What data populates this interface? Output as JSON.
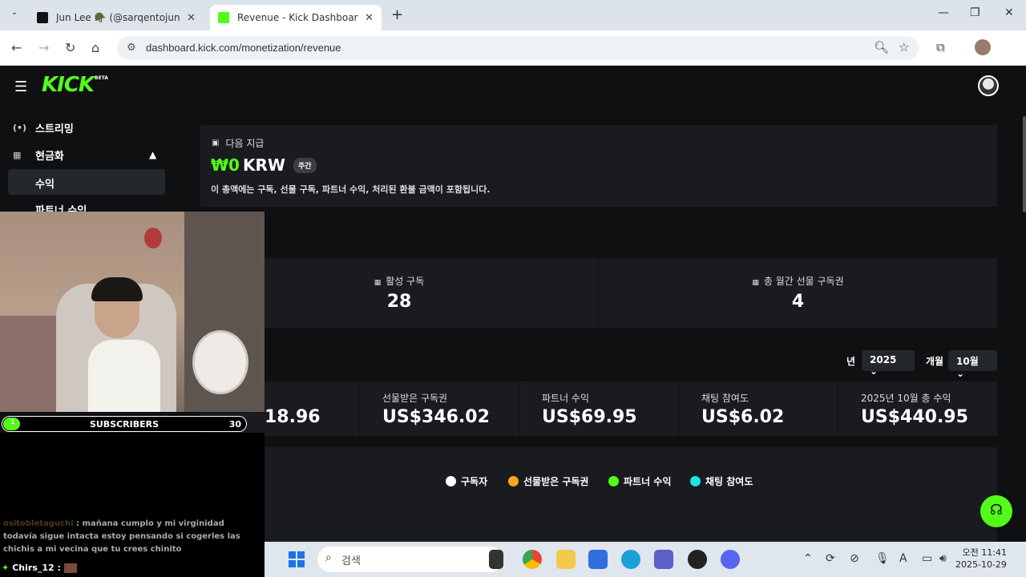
{
  "browser": {
    "tabs": [
      {
        "title": "Jun Lee 🪖 (@sarqentojunior_",
        "active": false
      },
      {
        "title": "Revenue - Kick Dashboard",
        "active": true
      }
    ],
    "url": "dashboard.kick.com/monetization/revenue",
    "icons": [
      "back-icon",
      "forward-icon",
      "reload-icon",
      "home-icon",
      "zoom-icon",
      "star-icon",
      "extensions-icon",
      "more-icon"
    ]
  },
  "header": {
    "logo": "KICK",
    "beta": "BETA"
  },
  "sidebar": {
    "items": [
      {
        "label": "스트리밍",
        "icon": "broadcast-icon"
      },
      {
        "label": "현금화",
        "icon": "chart-icon"
      }
    ],
    "sub_items": [
      {
        "label": "수익",
        "active": true
      },
      {
        "label": "파트너 수익",
        "active": false
      }
    ]
  },
  "payout": {
    "label": "다음 지급",
    "amount_symbol": "₩0",
    "currency": "KRW",
    "period_badge": "주간",
    "note": "이 총액에는 구독, 선물 구독, 파트너 수익, 처리된 환불 금액이 포함됩니다."
  },
  "stats": [
    {
      "label": "활성 구독",
      "value": "28"
    },
    {
      "label": "총 월간 선물 구독권",
      "value": "4"
    }
  ],
  "filters": {
    "year_label": "년",
    "year_value": "2025",
    "month_label": "개월",
    "month_value": "10월"
  },
  "revenue": [
    {
      "label": "",
      "value": "18.96"
    },
    {
      "label": "선물받은 구독권",
      "value": "US$346.02"
    },
    {
      "label": "파트너 수익",
      "value": "US$69.95"
    },
    {
      "label": "채팅 참여도",
      "value": "US$6.02"
    },
    {
      "label": "2025년 10월 총 수익",
      "value": "US$440.95"
    }
  ],
  "legend": [
    {
      "label": "구독자",
      "color": "#ffffff"
    },
    {
      "label": "선물받은 구독권",
      "color": "#f5a623"
    },
    {
      "label": "파트너 수익",
      "color": "#53fc18"
    },
    {
      "label": "채팅 참여도",
      "color": "#19e6e6"
    }
  ],
  "overlay": {
    "sub_current": "1",
    "sub_label": "SUBSCRIBERS",
    "sub_goal": "30",
    "sub_progress": 0.033,
    "chat": [
      {
        "user": "ositobletaguchi",
        "text": "mañana cumplo y mi virginidad todavía sigue intacta estoy pensando si cogerles las chichis a mi vecina que tu crees chinito"
      },
      {
        "user": "Chirs_12",
        "text": ""
      }
    ]
  },
  "taskbar": {
    "search_placeholder": "검색",
    "time": "오전 11:41",
    "date": "2025-10-29"
  },
  "colors": {
    "kick_green": "#53fc18",
    "background": "#0f1012",
    "card": "#191b1f"
  }
}
